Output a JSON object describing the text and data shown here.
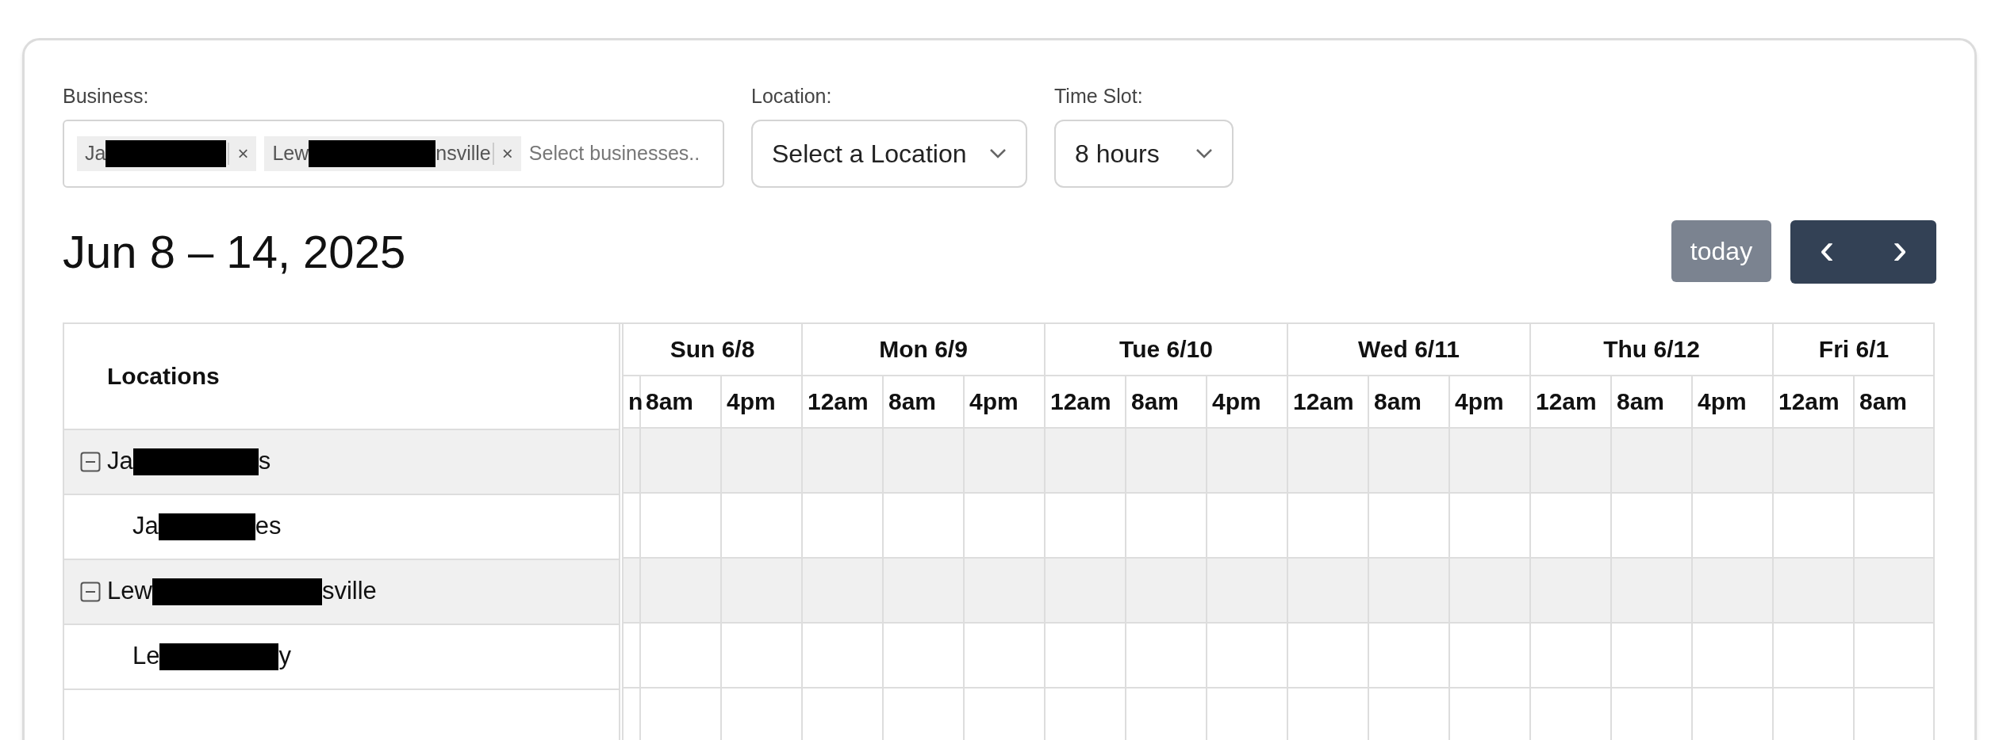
{
  "filters": {
    "business": {
      "label": "Business:",
      "tags": [
        {
          "parts": [
            "Ja"
          ]
        },
        {
          "parts": [
            "Lew",
            "nsville"
          ]
        }
      ],
      "remove": "×",
      "placeholder": "Select businesses.."
    },
    "location": {
      "label": "Location:",
      "value": "Select a Location"
    },
    "time_slot": {
      "label": "Time Slot:",
      "value": "8 hours"
    }
  },
  "title": "Jun 8 – 14, 2025",
  "toolbar": {
    "today": {
      "label": "today",
      "disabled": true
    },
    "prev": "‹",
    "next": "›"
  },
  "grid": {
    "resource_header": "Locations",
    "days": [
      {
        "label": "Sun 6/8",
        "slots": [
          "n",
          "8am",
          "4pm"
        ]
      },
      {
        "label": "Mon 6/9",
        "slots": [
          "12am",
          "8am",
          "4pm"
        ]
      },
      {
        "label": "Tue 6/10",
        "slots": [
          "12am",
          "8am",
          "4pm"
        ]
      },
      {
        "label": "Wed 6/11",
        "slots": [
          "12am",
          "8am",
          "4pm"
        ]
      },
      {
        "label": "Thu 6/12",
        "slots": [
          "12am",
          "8am",
          "4pm"
        ]
      },
      {
        "label": "Fri 6/1",
        "slots": [
          "12am",
          "8am"
        ]
      }
    ],
    "locations": [
      {
        "parts": [
          "Ja",
          "s"
        ],
        "expanded": true,
        "children": [
          {
            "parts": [
              "Ja",
              "es"
            ]
          }
        ]
      },
      {
        "parts": [
          "Lew",
          "sville"
        ],
        "expanded": true,
        "children": [
          {
            "parts": [
              "Le",
              "y"
            ]
          }
        ]
      }
    ]
  }
}
